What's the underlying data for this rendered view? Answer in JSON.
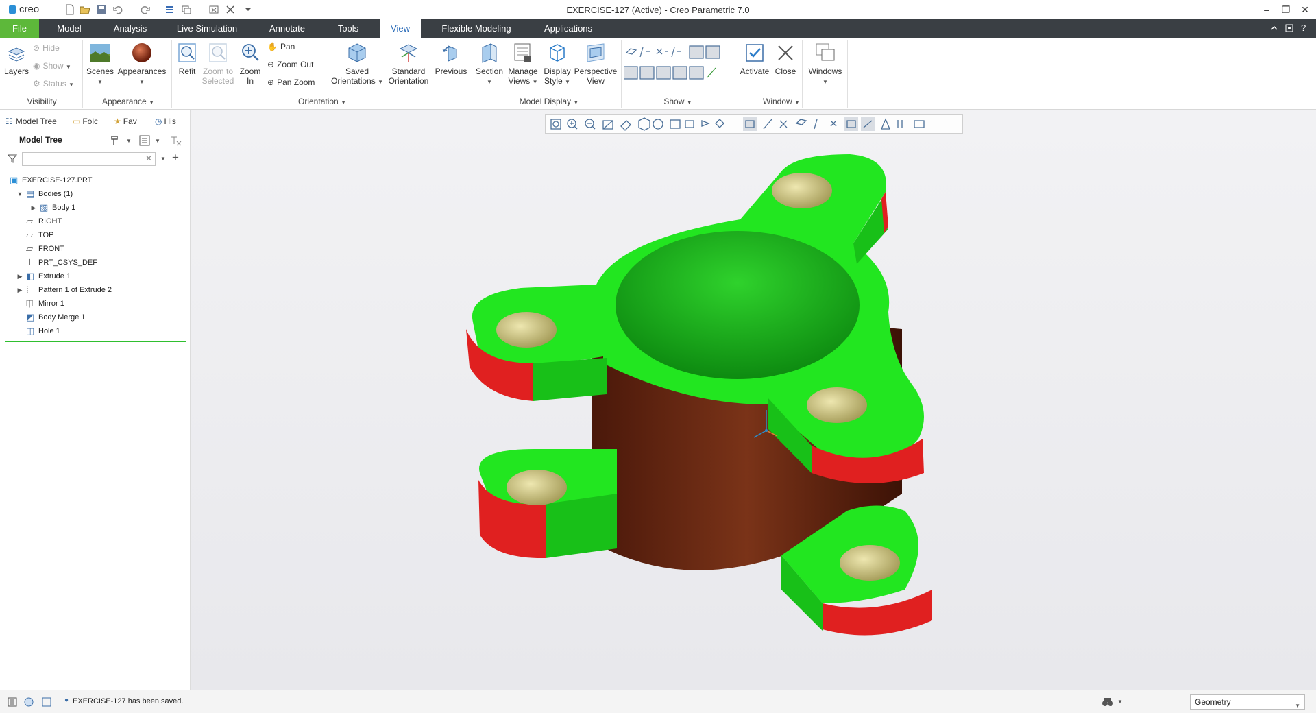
{
  "app": {
    "logo_text": "creo",
    "window_title": "EXERCISE-127 (Active) - Creo Parametric 7.0"
  },
  "ribbon_tabs": [
    "File",
    "Model",
    "Analysis",
    "Live Simulation",
    "Annotate",
    "Tools",
    "View",
    "Flexible Modeling",
    "Applications"
  ],
  "active_tab": "View",
  "ribbon": {
    "visibility": {
      "layers": "Layers",
      "hide": "Hide",
      "show": "Show",
      "status": "Status",
      "group": "Visibility"
    },
    "appearance": {
      "scenes": "Scenes",
      "appearances": "Appearances",
      "group": "Appearance"
    },
    "orientation": {
      "refit": "Refit",
      "zoom_to_selected_1": "Zoom to",
      "zoom_to_selected_2": "Selected",
      "zoom_in_1": "Zoom",
      "zoom_in_2": "In",
      "pan": "Pan",
      "zoom_out": "Zoom Out",
      "pan_zoom": "Pan Zoom",
      "saved_1": "Saved",
      "saved_2": "Orientations",
      "standard_1": "Standard",
      "standard_2": "Orientation",
      "previous": "Previous",
      "group": "Orientation"
    },
    "model_display": {
      "section": "Section",
      "manage_1": "Manage",
      "manage_2": "Views",
      "display_1": "Display",
      "display_2": "Style",
      "perspective_1": "Perspective",
      "perspective_2": "View",
      "group": "Model Display"
    },
    "show": {
      "group": "Show"
    },
    "window": {
      "activate": "Activate",
      "close": "Close",
      "windows": "Windows",
      "group": "Window"
    }
  },
  "left_panel": {
    "tabs": [
      "Model Tree",
      "Folder Browser",
      "Favorites",
      "History"
    ],
    "tab_short": [
      "Model Tree",
      "Folc",
      "Fav",
      "His"
    ],
    "header": "Model Tree",
    "search_value": "",
    "tree": [
      {
        "label": "EXERCISE-127.PRT",
        "indent": 0,
        "expander": "",
        "icon": "part-icon"
      },
      {
        "label": "Bodies (1)",
        "indent": 1,
        "expander": "▼",
        "icon": "bodies-icon"
      },
      {
        "label": "Body 1",
        "indent": 2,
        "expander": "▶",
        "icon": "body-icon"
      },
      {
        "label": "RIGHT",
        "indent": 1,
        "expander": "",
        "icon": "datum-plane-icon"
      },
      {
        "label": "TOP",
        "indent": 1,
        "expander": "",
        "icon": "datum-plane-icon"
      },
      {
        "label": "FRONT",
        "indent": 1,
        "expander": "",
        "icon": "datum-plane-icon"
      },
      {
        "label": "PRT_CSYS_DEF",
        "indent": 1,
        "expander": "",
        "icon": "csys-icon"
      },
      {
        "label": "Extrude 1",
        "indent": 1,
        "expander": "▶",
        "icon": "extrude-icon"
      },
      {
        "label": "Pattern 1 of Extrude 2",
        "indent": 1,
        "expander": "▶",
        "icon": "pattern-icon"
      },
      {
        "label": "Mirror 1",
        "indent": 1,
        "expander": "",
        "icon": "mirror-icon"
      },
      {
        "label": "Body Merge 1",
        "indent": 1,
        "expander": "",
        "icon": "body-merge-icon"
      },
      {
        "label": "Hole 1",
        "indent": 1,
        "expander": "",
        "icon": "hole-icon"
      }
    ]
  },
  "status": {
    "message": "EXERCISE-127 has been saved.",
    "selection_filter": "Geometry"
  },
  "colors": {
    "tabbar": "#3a3f44",
    "file_tab": "#5db83a",
    "active_tab_text": "#2a6bb8",
    "model_top": "#22e620",
    "model_side": "#e02020",
    "model_cylinder": "#6b2a14",
    "hole_face": "#d8cf83"
  }
}
